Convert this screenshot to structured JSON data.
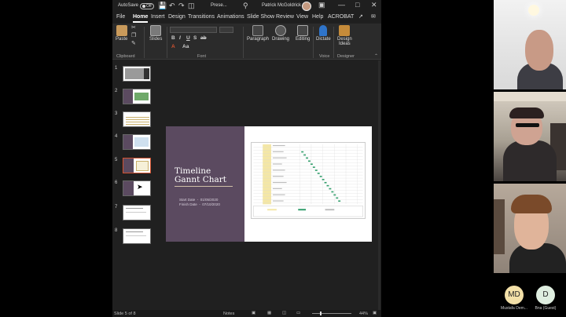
{
  "titlebar": {
    "autosave_label": "AutoSave",
    "autosave_state": "Off",
    "doc_title": "Prese...",
    "user_name": "Patrick McGoldrick"
  },
  "menu": [
    "File",
    "Home",
    "Insert",
    "Design",
    "Transitions",
    "Animations",
    "Slide Show",
    "Review",
    "View",
    "Help",
    "ACROBAT"
  ],
  "ribbon": {
    "paste": "Paste",
    "clipboard": "Clipboard",
    "slides": "Slides",
    "font": "Font",
    "paragraph": "Paragraph",
    "drawing": "Drawing",
    "editing": "Editing",
    "dictate": "Dictate",
    "design_ideas_1": "Design",
    "design_ideas_2": "Ideas",
    "voice": "Voice",
    "designer": "Designer",
    "fmt": [
      "B",
      "I",
      "U",
      "S",
      "ab",
      "Aa"
    ]
  },
  "thumbnails": [
    "1",
    "2",
    "3",
    "4",
    "5",
    "6",
    "7",
    "8"
  ],
  "slide": {
    "title_line1": "Timeline",
    "title_line2": "Gannt Chart",
    "start_label": "Start Date",
    "start_value": "01/05/2020",
    "finish_label": "Finish Date",
    "finish_value": "07/10/2020"
  },
  "status": {
    "slide_info": "Slide 5 of 8",
    "notes": "Notes",
    "zoom": "44%"
  },
  "participants": {
    "p4_initials": "MD",
    "p4_name": "Mustafa Dem...",
    "p5_initials": "D",
    "p5_name": "Bna (Guest)"
  },
  "colors": {
    "accent": "#d35230",
    "slide_panel": "#5b4a60",
    "badge_md": "#f3e0a8",
    "badge_d": "#dfeee0"
  }
}
